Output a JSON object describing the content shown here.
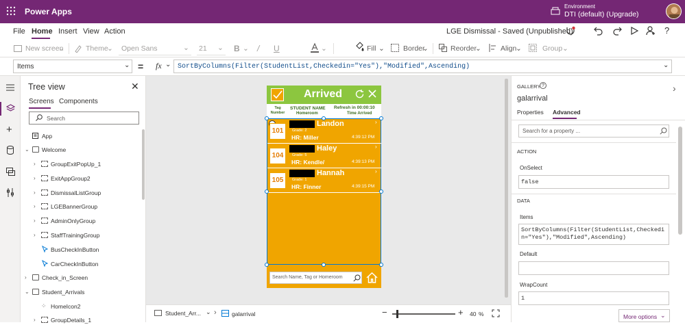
{
  "titlebar": {
    "app_name": "Power Apps",
    "env_label": "Environment",
    "env_name": "DTI (default) (Upgrade)"
  },
  "menu": {
    "items": [
      "File",
      "Home",
      "Insert",
      "View",
      "Action"
    ],
    "active": "Home",
    "doc_status": "LGE Dismissal - Saved (Unpublished)"
  },
  "ribbon": {
    "new_screen": "New screen",
    "theme": "Theme",
    "font": "Open Sans",
    "font_size": "21",
    "bold": "B",
    "fill": "Fill",
    "border": "Border",
    "reorder": "Reorder",
    "align": "Align",
    "group": "Group"
  },
  "formula": {
    "property": "Items",
    "eq": "=",
    "fx": "fx",
    "expression": "SortByColumns(Filter(StudentList,Checkedin=\"Yes\"),\"Modified\",Ascending)"
  },
  "tree": {
    "title": "Tree view",
    "tabs": [
      "Screens",
      "Components"
    ],
    "search_placeholder": "Search",
    "app_label": "App",
    "welcome": "Welcome",
    "welcome_children": [
      "GroupExitPopUp_1",
      "ExitAppGroup2",
      "DismissalListGroup",
      "LGEBannerGroup",
      "AdminOnlyGroup",
      "StaffTrainingGroup",
      "BusCheckInButton",
      "CarCheckInButton"
    ],
    "check_in": "Check_in_Screen",
    "student_arrivals": "Student_Arrivals",
    "sa_children": [
      "HomeIcon2",
      "GroupDetails_1"
    ]
  },
  "app_screen": {
    "header_title": "Arrived",
    "col_tag": "Tag Number",
    "col_name": "STUDENT NAME",
    "col_homeroom": "Homeroom",
    "refresh": "Refresh in 00:00:10",
    "col_time": "Time Arrived",
    "students": [
      {
        "tag": "101",
        "name": "Landon",
        "grade": "Grade: 2",
        "hr": "HR: Miller",
        "time": "4:39:12 PM"
      },
      {
        "tag": "104",
        "name": "Haley",
        "grade": "Grade: 5",
        "hr": "HR: Kendle/",
        "time": "4:39:13 PM"
      },
      {
        "tag": "105",
        "name": "Hannah",
        "grade": "Grade: 1",
        "hr": "HR: Finner",
        "time": "4:39:15 PM"
      }
    ],
    "search_placeholder": "Search Name, Tag or Homeroom"
  },
  "bottombar": {
    "screen": "Student_Arr...",
    "control": "galarrival",
    "zoom": "40",
    "zoom_unit": "%"
  },
  "props": {
    "type": "GALLERY",
    "name": "galarrival",
    "tabs": [
      "Properties",
      "Advanced"
    ],
    "active_tab": "Advanced",
    "search_placeholder": "Search for a property ...",
    "action_header": "ACTION",
    "onselect_label": "OnSelect",
    "onselect_value": "false",
    "data_header": "DATA",
    "items_label": "Items",
    "items_value": "SortByColumns(Filter(StudentList,Checkedin=\"Yes\"),\"Modified\",Ascending)",
    "default_label": "Default",
    "default_value": "",
    "wrapcount_label": "WrapCount",
    "wrapcount_value": "1",
    "more_options": "More options"
  },
  "colors": {
    "brand": "#742774",
    "app_header": "#8cc63f",
    "app_body": "#f0a500",
    "selection": "#0078d4"
  }
}
